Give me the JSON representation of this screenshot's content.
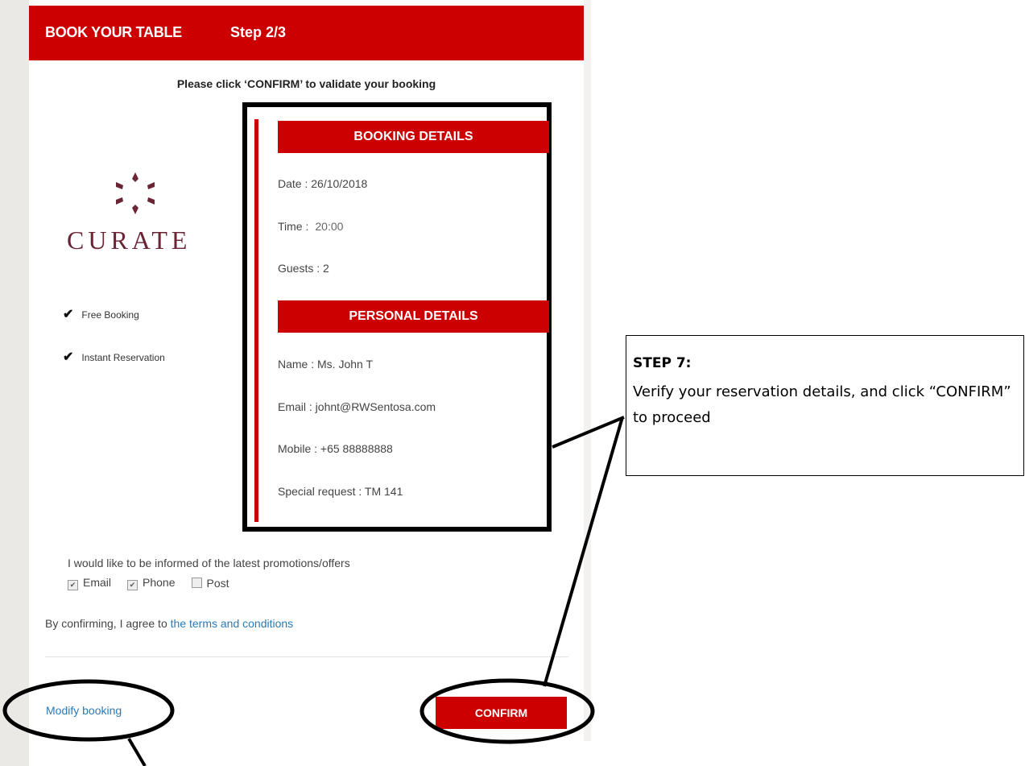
{
  "header": {
    "title": "BOOK YOUR TABLE",
    "step": "Step 2/3"
  },
  "instruction": "Please click ‘CONFIRM’ to validate your booking",
  "logo": {
    "text": "CURATE"
  },
  "features": [
    {
      "icon": "checkmark-icon",
      "label": "Free Booking"
    },
    {
      "icon": "checkmark-icon",
      "label": "Instant Reservation"
    }
  ],
  "booking": {
    "heading": "BOOKING DETAILS",
    "date": "Date : 26/10/2018",
    "time_label": "Time :",
    "time_value": "20:00",
    "guests": "Guests : 2"
  },
  "personal": {
    "heading": "PERSONAL DETAILS",
    "name": "Name : Ms. John T",
    "email": "Email : johnt@RWSentosa.com",
    "mobile": "Mobile : +65 88888888",
    "special": "Special request : TM 141"
  },
  "promotions": {
    "label": "I would like to be informed of the latest promotions/offers",
    "options": [
      {
        "label": "Email",
        "checked": true
      },
      {
        "label": "Phone",
        "checked": true
      },
      {
        "label": "Post",
        "checked": false
      }
    ]
  },
  "terms": {
    "prefix": "By confirming, I agree to",
    "link": "the terms and conditions"
  },
  "actions": {
    "modify": "Modify booking",
    "confirm": "CONFIRM"
  },
  "callout": {
    "heading": "STEP 7:",
    "body": "Verify your reservation details, and click “CONFIRM” to proceed"
  },
  "colors": {
    "brand_red": "#cc0000",
    "link_blue": "#2a7ab8",
    "logo_maroon": "#6a2535"
  }
}
